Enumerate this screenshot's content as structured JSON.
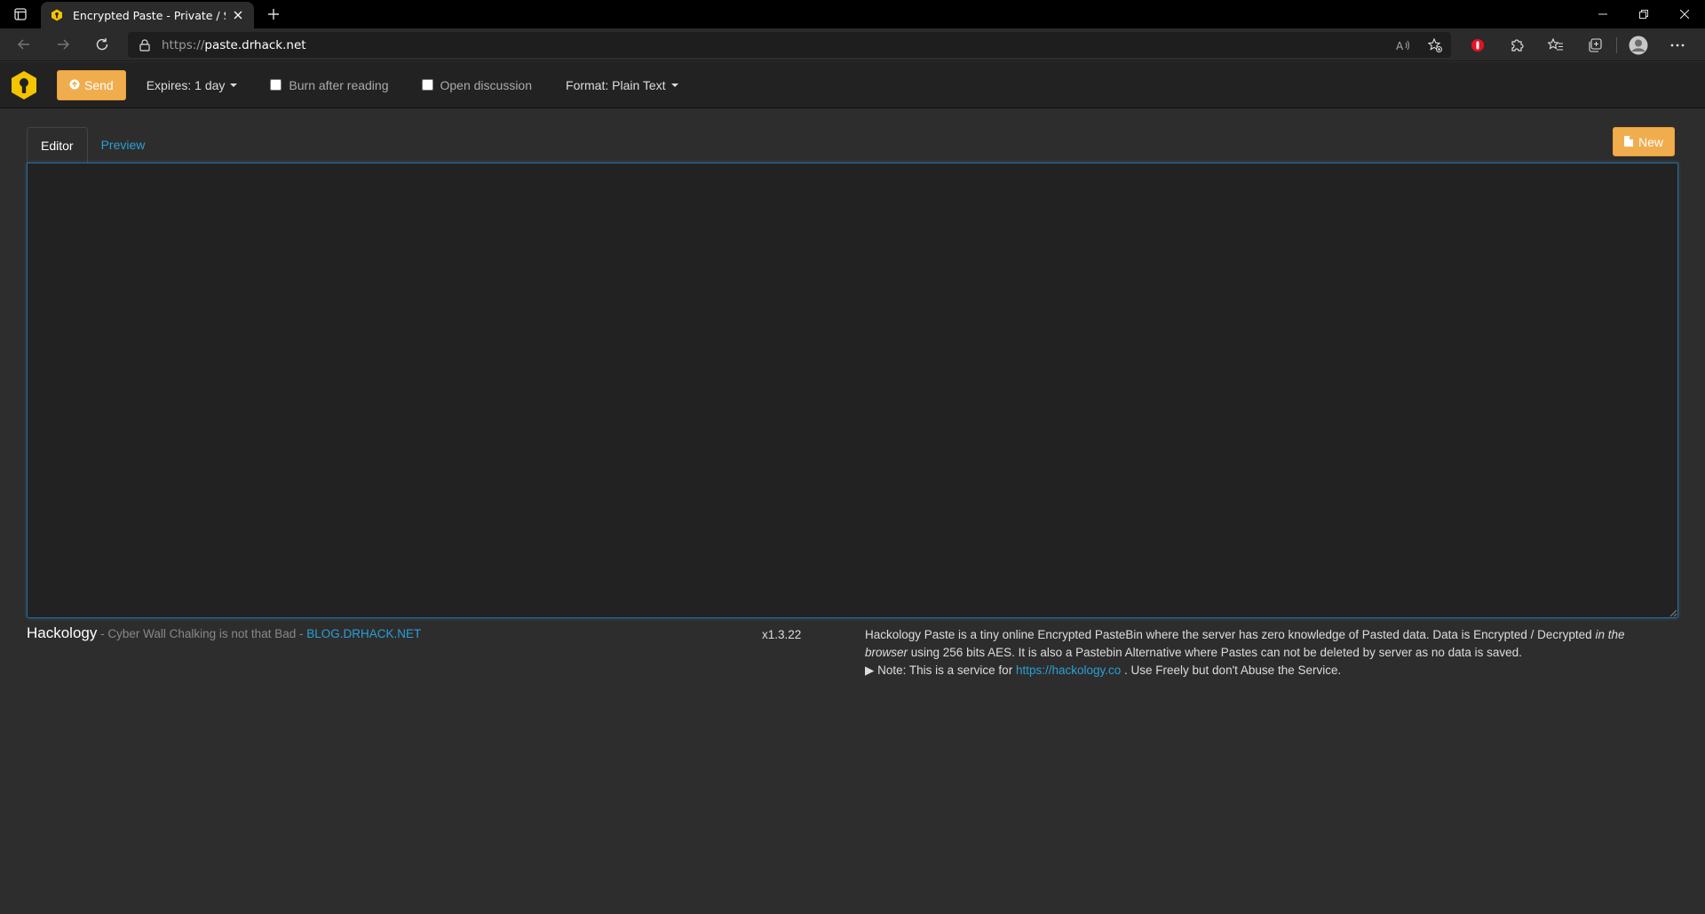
{
  "browser": {
    "tab_title": "Encrypted Paste - Private / Secure",
    "url_scheme": "https://",
    "url_host": "paste.drhack.net"
  },
  "toolbar": {
    "send_label": "Send",
    "expires_label": "Expires: 1 day",
    "burn_label": "Burn after reading",
    "discussion_label": "Open discussion",
    "format_label": "Format: Plain Text"
  },
  "editor": {
    "tab_editor": "Editor",
    "tab_preview": "Preview",
    "new_label": "New",
    "content": ""
  },
  "footer": {
    "brand": "Hackology",
    "tagline": " - Cyber Wall Chalking is not that Bad - ",
    "blog_link": "BLOG.DRHACK.NET",
    "version": "x1.3.22",
    "about_part1": "Hackology Paste is a tiny online Encrypted PasteBin where the server has zero knowledge of Pasted data. Data is Encrypted / Decrypted ",
    "about_em": "in the browser",
    "about_part2": " using 256 bits AES. It is also a Pastebin Alternative where Pastes can not be deleted by server as no data is saved.",
    "note_prefix": "▶ Note: This is a service for ",
    "note_link": "https://hackology.co",
    "note_suffix": " . Use Freely but don't Abuse the Service."
  },
  "colors": {
    "accent": "#f0ad4e",
    "link": "#2a9fd6",
    "background": "#2d2d2d"
  }
}
